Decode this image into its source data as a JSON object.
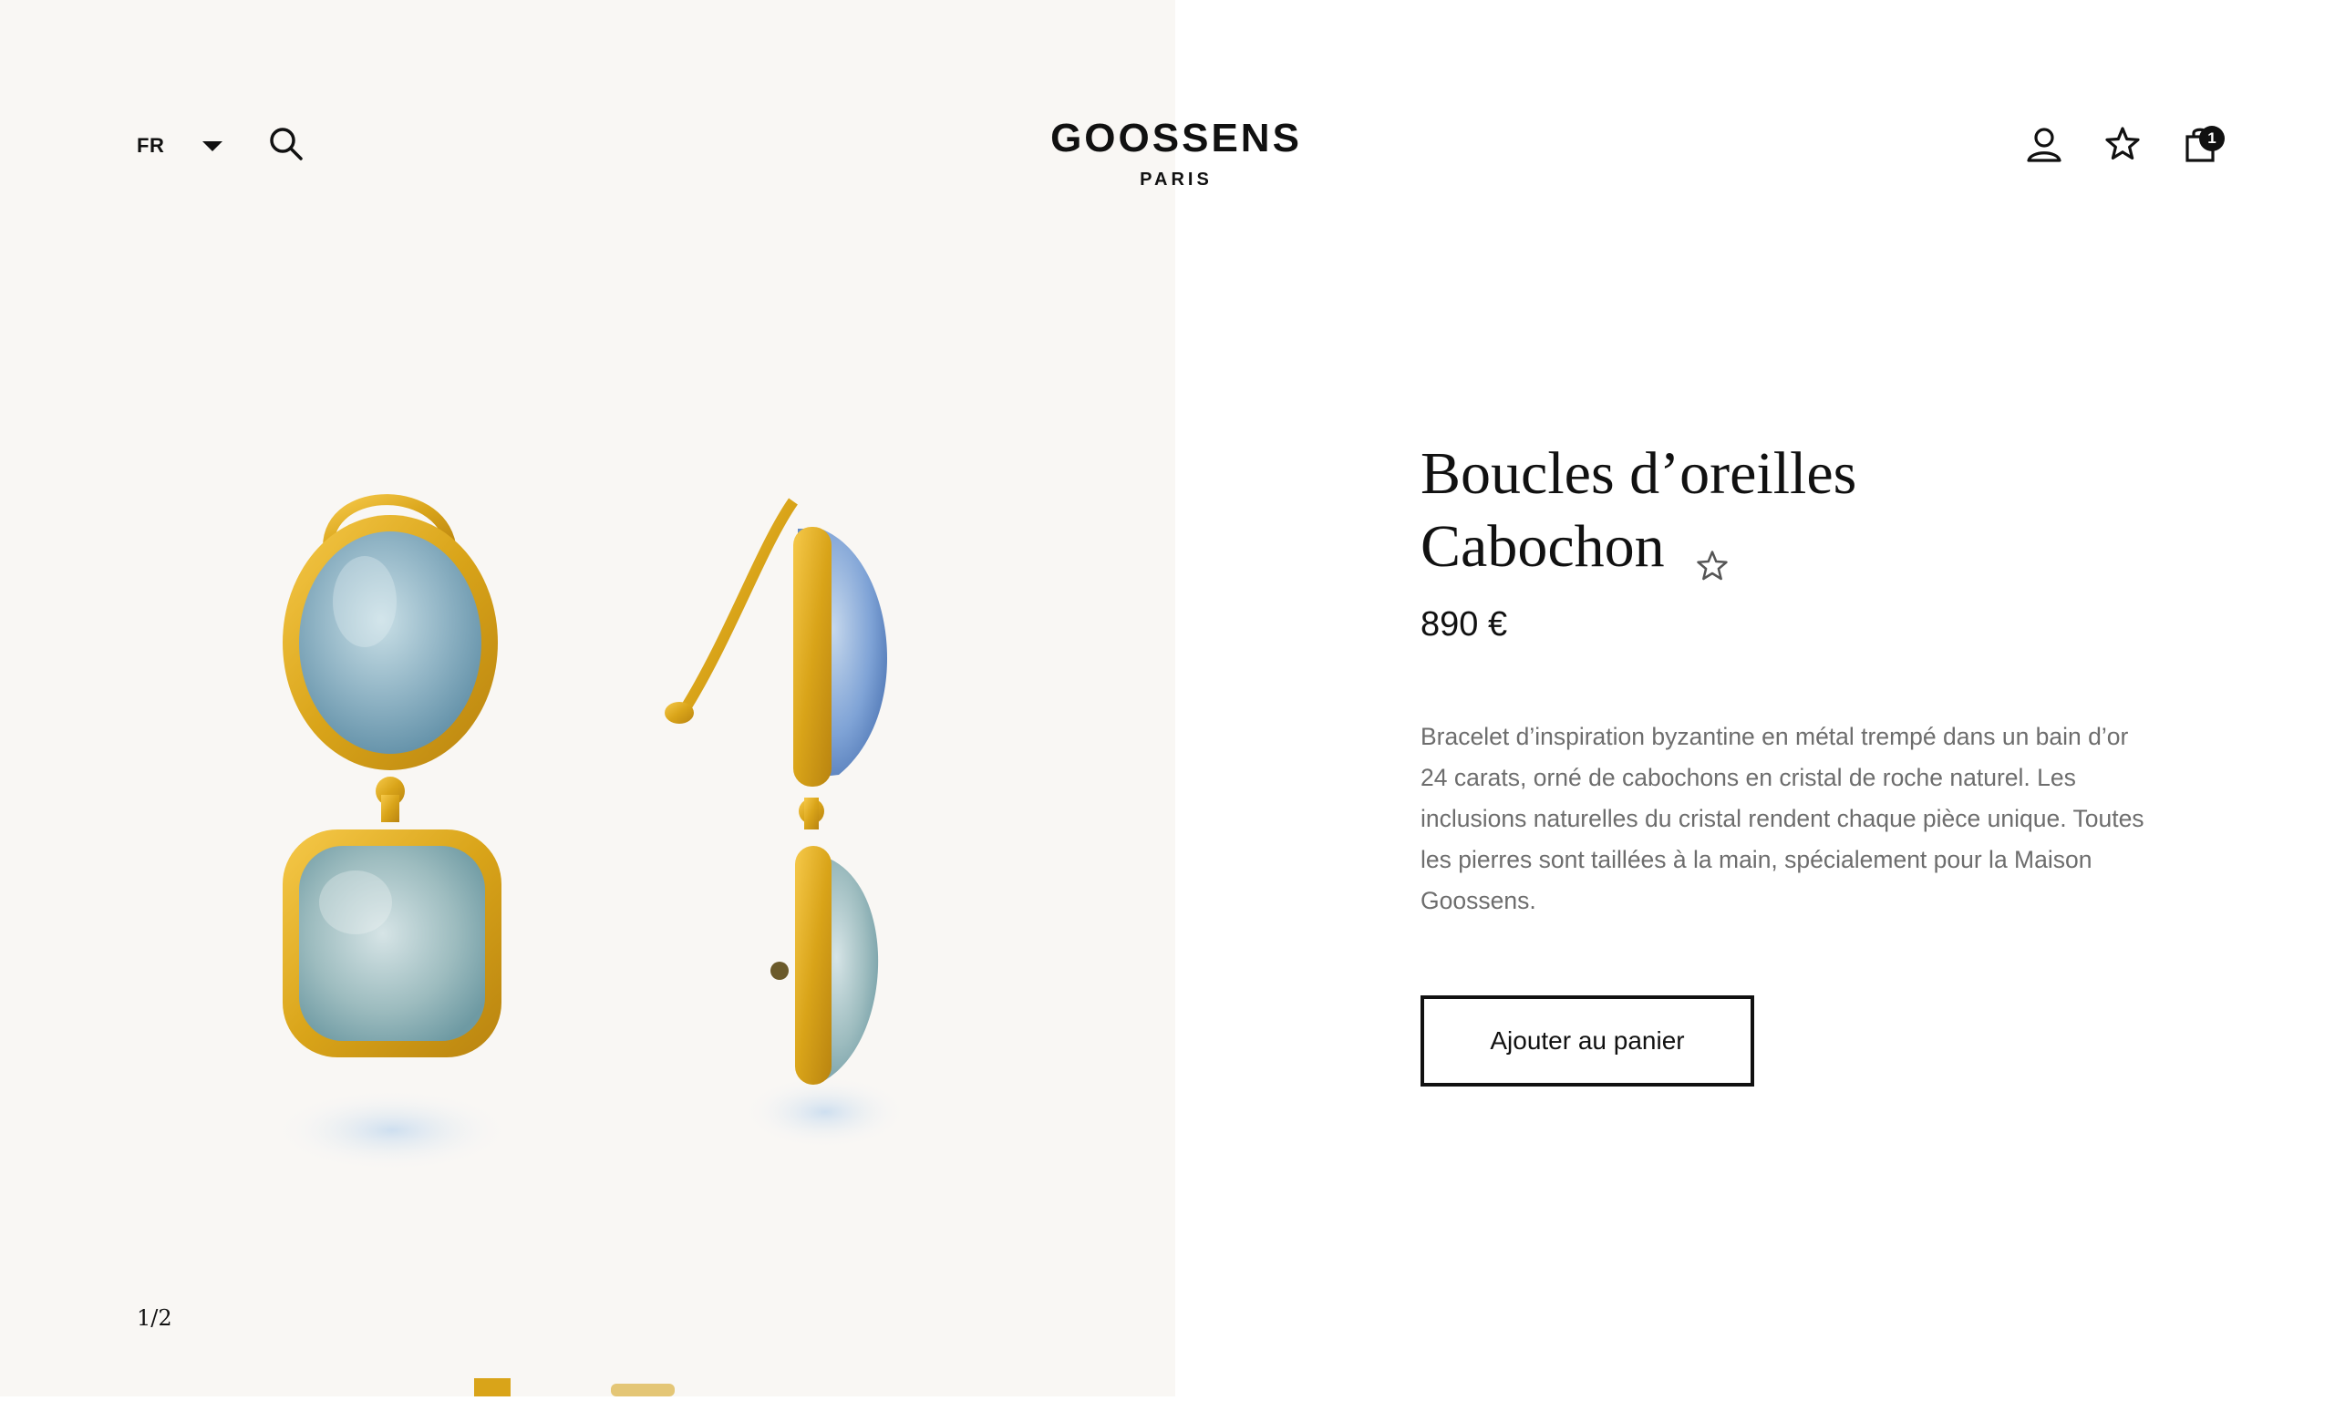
{
  "header": {
    "language": "FR",
    "logo_main": "GOOSSENS",
    "logo_sub": "PARIS",
    "cart_count": "1",
    "icons": {
      "search": "search-icon",
      "account": "user-icon",
      "wishlist": "star-icon",
      "cart": "shopping-bag-icon",
      "language_dropdown": "caret-down-icon"
    }
  },
  "gallery": {
    "pagination": "1/2"
  },
  "product": {
    "title_line1": "Boucles d’oreilles",
    "title_line2": "Cabochon",
    "price": "890 €",
    "description": "Bracelet d’inspiration byzantine en métal trempé dans un bain d’or 24 carats, orné de cabochons en cristal de roche naturel. Les inclusions naturelles du cristal rendent chaque pièce unique. Toutes les pierres sont taillées à la main, spécialement pour la Maison Goossens.",
    "add_to_cart": "Ajouter au panier"
  },
  "colors": {
    "left_background": "#f9f7f4",
    "gold": "#d9a419",
    "stone": "#8fb3c4",
    "text": "#111111",
    "description_text": "#6d6d6d"
  }
}
